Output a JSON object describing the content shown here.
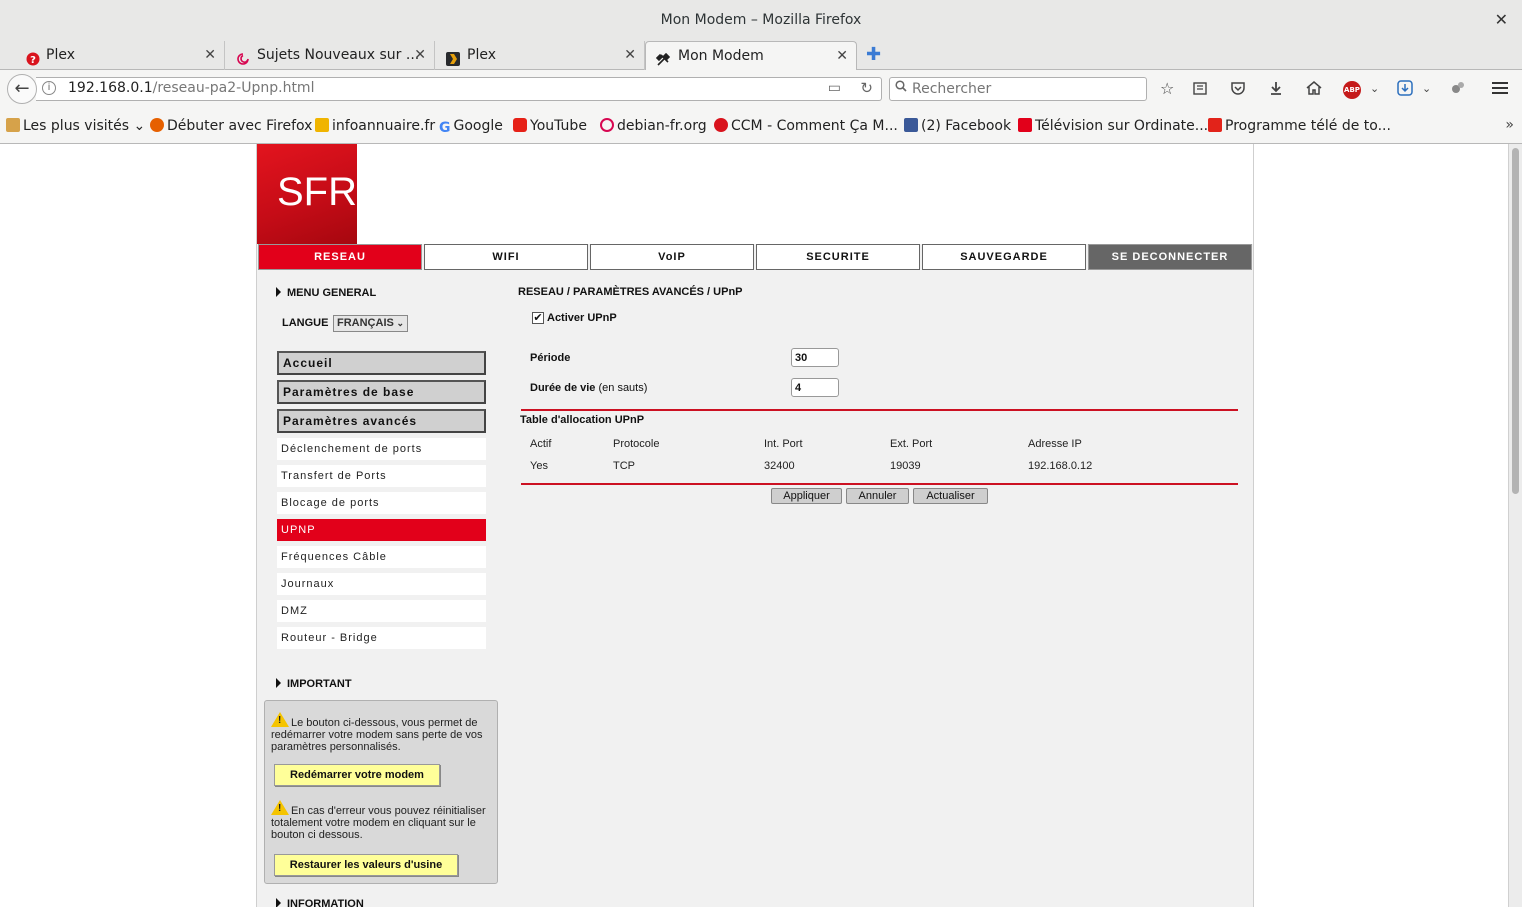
{
  "window": {
    "title": "Mon Modem – Mozilla Firefox"
  },
  "tabs": [
    {
      "label": "Plex",
      "icon": "plex-red-icon"
    },
    {
      "label": "Sujets Nouveaux sur ...",
      "icon": "debian-swirl-icon"
    },
    {
      "label": "Plex",
      "icon": "plex-chevron-icon"
    },
    {
      "label": "Mon Modem",
      "icon": "tools-icon"
    }
  ],
  "navbar": {
    "url_host": "192.168.0.1",
    "url_path": "/reseau-pa2-Upnp.html",
    "search_placeholder": "Rechercher",
    "abp_label": "ABP"
  },
  "bookmarks": [
    {
      "label": "Les plus visités",
      "color": "#b86b00"
    },
    {
      "label": "Débuter avec Firefox",
      "color": "#e66000"
    },
    {
      "label": "infoannuaire.fr",
      "color": "#f0b400"
    },
    {
      "label": "Google",
      "color": "#4285f4"
    },
    {
      "label": "YouTube",
      "color": "#e62117"
    },
    {
      "label": "debian-fr.org",
      "color": "#d70751"
    },
    {
      "label": "CCM - Comment Ça M...",
      "color": "#d9131d"
    },
    {
      "label": "(2) Facebook",
      "color": "#3b5998"
    },
    {
      "label": "Télévision sur Ordinate...",
      "color": "#e2001a"
    },
    {
      "label": "Programme télé de to...",
      "color": "#e2231a"
    }
  ],
  "page": {
    "logo": "SFR",
    "topnav": [
      "RESEAU",
      "WIFI",
      "VoIP",
      "SECURITE",
      "SAUVEGARDE",
      "SE DECONNECTER"
    ],
    "sidebar": {
      "menu_general": "MENU GENERAL",
      "langue_label": "LANGUE",
      "langue_value": "FRANÇAIS",
      "main_items": [
        "Accueil",
        "Paramètres de base",
        "Paramètres avancés"
      ],
      "sub_items": [
        "Déclenchement de ports",
        "Transfert de Ports",
        "Blocage de ports",
        "UPNP",
        "Fréquences Câble",
        "Journaux",
        "DMZ",
        "Routeur - Bridge"
      ],
      "active_sub": "UPNP",
      "important": "IMPORTANT",
      "warn1": "Le bouton ci-dessous, vous permet de redémarrer votre modem sans perte de vos paramètres personnalisés.",
      "restart_button": "Redémarrer votre modem",
      "warn2": "En cas d'erreur vous pouvez réinitialiser totalement votre modem en cliquant sur le bouton ci dessous.",
      "restore_button": "Restaurer les valeurs d'usine",
      "information": "INFORMATION"
    },
    "main": {
      "breadcrumb": "RESEAU / PARAMÈTRES AVANCÉS / UPnP",
      "enable_label": "Activer UPnP",
      "enable_checked": true,
      "periode_label": "Période",
      "periode_value": "30",
      "duree_label": "Durée de vie",
      "duree_hint": "(en sauts)",
      "duree_value": "4",
      "table_title": "Table d'allocation UPnP",
      "table_headers": [
        "Actif",
        "Protocole",
        "Int. Port",
        "Ext. Port",
        "Adresse IP"
      ],
      "table_rows": [
        [
          "Yes",
          "TCP",
          "32400",
          "19039",
          "192.168.0.12"
        ]
      ],
      "buttons": [
        "Appliquer",
        "Annuler",
        "Actualiser"
      ]
    }
  }
}
